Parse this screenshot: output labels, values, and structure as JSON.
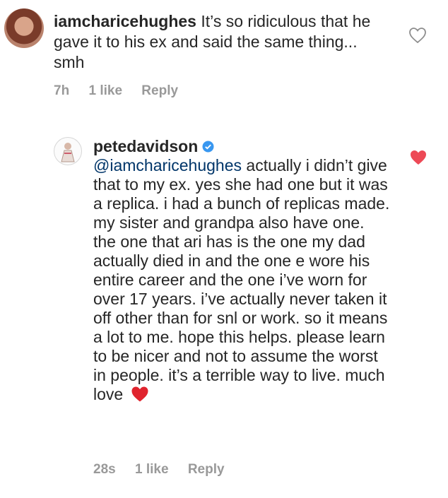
{
  "comments": [
    {
      "username": "iamcharicehughes",
      "text": "It’s so ridiculous that he gave it to his ex and said the same thing... smh",
      "time": "7h",
      "likes": "1 like",
      "reply_label": "Reply",
      "liked": false,
      "verified": false
    },
    {
      "username": "petedavidson",
      "mention": "@iamcharicehughes",
      "text": "actually i didn’t give that to my ex. yes she had one but it was a replica. i had a bunch of replicas made. my sister and grandpa also have one. the one that ari has is the one my dad actually died in and the one e wore his entire career and the one i’ve worn for over 17 years. i’ve actually never taken it off other than for snl or work. so it means a lot to me. hope this helps. please learn to be nicer and not to assume the worst in people. it’s a terrible way to live. much love",
      "time": "28s",
      "likes": "1 like",
      "reply_label": "Reply",
      "liked": true,
      "verified": true
    }
  ],
  "colors": {
    "text": "#262626",
    "meta": "#999999",
    "mention": "#003569",
    "like_red": "#ed4956",
    "verified_blue": "#3897f0"
  },
  "icons": {
    "like_outline": "heart-outline-icon",
    "like_filled": "heart-filled-icon",
    "verified": "verified-badge-icon",
    "emoji": "red-heart-emoji"
  }
}
